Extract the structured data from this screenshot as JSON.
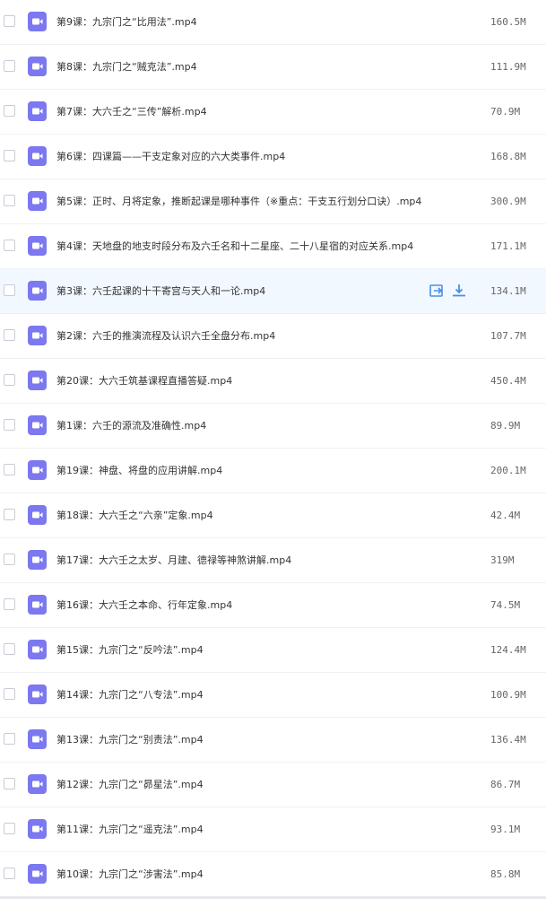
{
  "colors": {
    "accent": "#7b78f0",
    "action": "#4a90e2",
    "hover_bg": "#f2f8ff"
  },
  "files": [
    {
      "name": "第9课：九宗门之“比用法”.mp4",
      "size": "160.5M"
    },
    {
      "name": "第8课：九宗门之“贼克法”.mp4",
      "size": "111.9M"
    },
    {
      "name": "第7课：大六壬之“三传”解析.mp4",
      "size": "70.9M"
    },
    {
      "name": "第6课：四课篇——干支定象对应的六大类事件.mp4",
      "size": "168.8M"
    },
    {
      "name": "第5课：正时、月将定象，推断起课是哪种事件（※重点：干支五行划分口诀）.mp4",
      "size": "300.9M"
    },
    {
      "name": "第4课：天地盘的地支时段分布及六壬名和十二星座、二十八星宿的对应关系.mp4",
      "size": "171.1M"
    },
    {
      "name": "第3课：六壬起课的十干寄宫与天人和一论.mp4",
      "size": "134.1M",
      "hover": true
    },
    {
      "name": "第2课：六壬的推演流程及认识六壬全盘分布.mp4",
      "size": "107.7M"
    },
    {
      "name": "第20课：大六壬筑基课程直播答疑.mp4",
      "size": "450.4M"
    },
    {
      "name": "第1课：六壬的源流及准确性.mp4",
      "size": "89.9M"
    },
    {
      "name": "第19课：神盘、将盘的应用讲解.mp4",
      "size": "200.1M"
    },
    {
      "name": "第18课：大六壬之“六亲”定象.mp4",
      "size": "42.4M"
    },
    {
      "name": "第17课：大六壬之太岁、月建、德禄等神煞讲解.mp4",
      "size": "319M"
    },
    {
      "name": "第16课：大六壬之本命、行年定象.mp4",
      "size": "74.5M"
    },
    {
      "name": "第15课：九宗门之“反吟法”.mp4",
      "size": "124.4M"
    },
    {
      "name": "第14课：九宗门之“八专法”.mp4",
      "size": "100.9M"
    },
    {
      "name": "第13课：九宗门之“别责法”.mp4",
      "size": "136.4M"
    },
    {
      "name": "第12课：九宗门之“昴星法”.mp4",
      "size": "86.7M"
    },
    {
      "name": "第11课：九宗门之“遥克法”.mp4",
      "size": "93.1M"
    },
    {
      "name": "第10课：九宗门之“涉害法”.mp4",
      "size": "85.8M"
    }
  ],
  "icons": {
    "file": "video-file-icon",
    "share": "share-icon",
    "download": "download-icon"
  }
}
